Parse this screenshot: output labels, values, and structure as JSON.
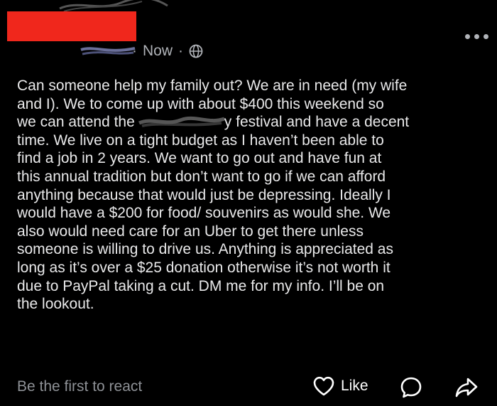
{
  "post": {
    "timestamp": "Now",
    "separator": "·",
    "audience_icon": "globe-icon",
    "more_icon": "more-options-icon",
    "body_lines": [
      "Can someone help my family out? We are in need (my wife",
      "and I). We to come up with about $400 this weekend so",
      "we can attend the",
      "y festival and have a decent",
      "time. We live on a tight budget as I haven’t been able to",
      "find a job in 2 years. We want to go out and have fun at",
      "this annual tradition but don’t want to go if we can afford",
      "anything because that would just be depressing. Ideally I",
      "would have a $200 for food/ souvenirs as would she. We",
      "also would need care for an Uber to get there unless",
      "someone is willing to drive us.  Anything is appreciated as",
      "long as it’s over a $25 donation otherwise it’s not worth it",
      "due to PayPal taking a cut. DM me for my info. I’ll be on",
      "the lookout."
    ]
  },
  "footer": {
    "react_prompt": "Be the first to react",
    "like_label": "Like",
    "like_icon": "heart-icon",
    "comment_icon": "comment-icon",
    "share_icon": "share-icon"
  },
  "colors": {
    "background": "#000000",
    "text": "#e9e9ea",
    "muted": "#8e9196",
    "redaction": "#f0271c"
  }
}
